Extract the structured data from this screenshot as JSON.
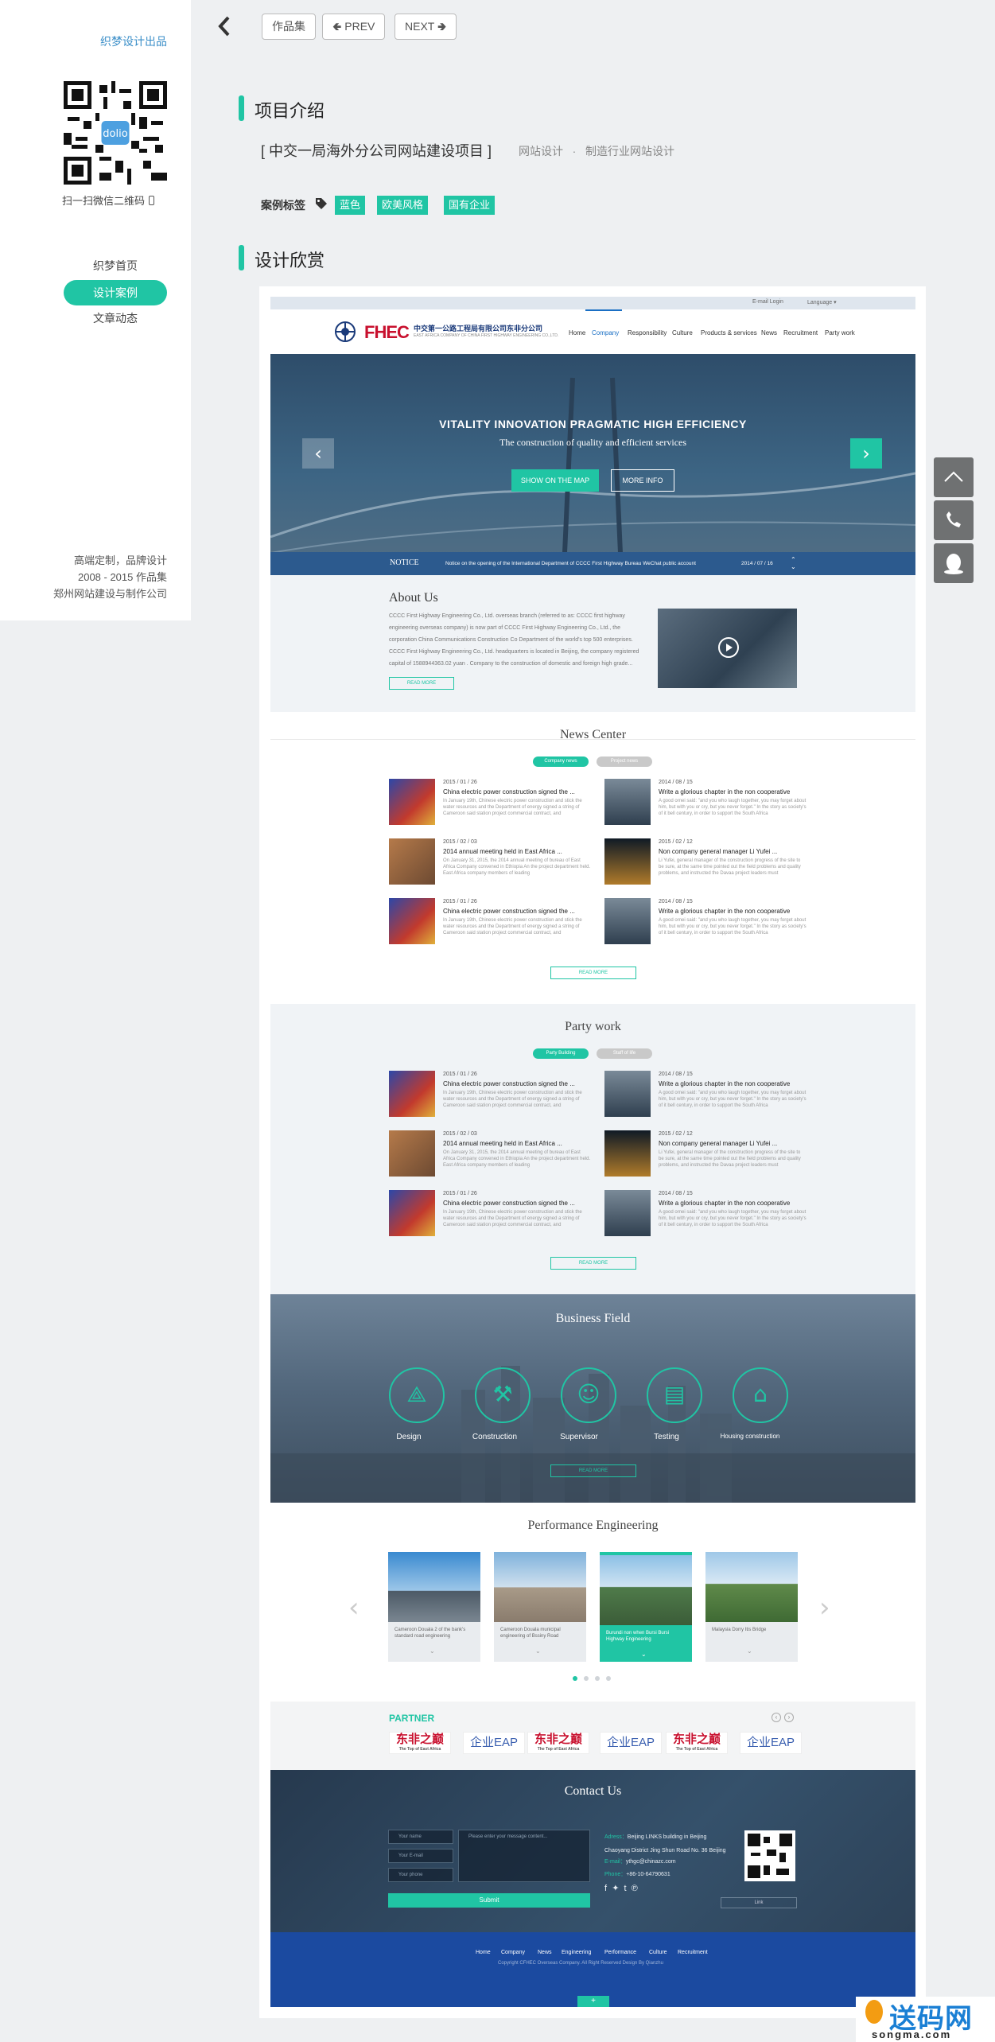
{
  "sidebar": {
    "brand": "织梦设计出品",
    "qr_caption": "扫一扫微信二维码",
    "qr_center": "dolio",
    "nav": [
      "织梦首页",
      "设计案例",
      "文章动态"
    ],
    "footer": [
      "高端定制，品牌设计",
      "2008 - 2015 作品集",
      "郑州网站建设与制作公司"
    ]
  },
  "toolbar": {
    "collection": "作品集",
    "prev": "PREV",
    "next": "NEXT"
  },
  "intro": {
    "heading": "项目介绍",
    "project_title": "[ 中交一局海外分公司网站建设项目 ]",
    "category1": "网站设计",
    "sep": "·",
    "category2": "制造行业网站设计",
    "tags_label": "案例标签",
    "tags": [
      "蓝色",
      "欧美风格",
      "国有企业"
    ]
  },
  "showcase": {
    "heading": "设计欣赏"
  },
  "mock": {
    "topbar": {
      "login": "E-mail Login",
      "language": "Language ▾"
    },
    "logo": {
      "mark": "FHEC",
      "cn": "中交第一公路工程局有限公司东非分公司",
      "en": "EAST AFRICA COMPANY OF CHINA FIRST HIGHWAY ENGINEERING CO.,LTD."
    },
    "menu": [
      "Home",
      "Company",
      "Responsibility",
      "Culture",
      "Products & services",
      "News",
      "Recruitment",
      "Party work"
    ],
    "hero": {
      "headline": "VITALITY  INNOVATION  PRAGMATIC  HIGH EFFICIENCY",
      "sub": "The construction of quality and efficient services",
      "btn_map": "SHOW ON THE MAP",
      "btn_more": "MORE INFO",
      "notice_label": "NOTICE",
      "notice_text": "Notice on the opening of the International Department of CCCC First Highway Bureau WeChat public account",
      "notice_date": "2014 / 07 / 16"
    },
    "about": {
      "title": "About Us",
      "text": "CCCC First Highway Engineering Co., Ltd. overseas branch (referred to as: CCCC first highway engineering overseas company) is now part of CCCC First Highway Engineering Co., Ltd., the corporation China Communications Construction Co Department of the world's top 500 enterprises. CCCC First Highway Engineering Co., Ltd. headquarters is located in Beijing, the company registered capital of 1588944363.02 yuan . Company to the construction of domestic and foreign high grade...",
      "read_more": "READ MORE"
    },
    "news": {
      "title": "News Center",
      "tabs": [
        "Company news",
        "Project news"
      ],
      "read_more": "READ MORE",
      "items": [
        {
          "date": "2015 / 01 / 26",
          "title": "China electric power construction signed the ...",
          "desc": "In January 19th, Chinese electric power construction and stick the water resources and the Department of energy signed a string of Cameroon said station project commercial contract, and"
        },
        {
          "date": "2014 / 08 / 15",
          "title": "Write a glorious chapter in the non cooperative",
          "desc": "A good ornei said: \"and you who laugh together, you may forget about him, but with you or cry, but you never forget.\" In the story as society's of it bell century, in order to support the South Africa"
        },
        {
          "date": "2015 / 02 / 03",
          "title": "2014 annual meeting held in East Africa ...",
          "desc": "On January 31, 2015, the 2014 annual meeting of bureau of East Africa Company convened in Ethiopia An the project department held. East Africa company members of leading"
        },
        {
          "date": "2015 / 02 / 12",
          "title": "Non company general manager Li Yufei ...",
          "desc": "Li Yufei, general manager of the construction progress of the site to be sure, at the same time pointed out the field problems and quality problems, and instructed the Davaa project leaders must"
        },
        {
          "date": "2015 / 01 / 26",
          "title": "China electric power construction signed the ...",
          "desc": "In January 19th, Chinese electric power construction and stick the water resources and the Department of energy signed a string of Cameroon said station project commercial contract, and"
        },
        {
          "date": "2014 / 08 / 15",
          "title": "Write a glorious chapter in the non cooperative",
          "desc": "A good ornei said: \"and you who laugh together, you may forget about him, but with you or cry, but you never forget.\" In the story as society's of it bell century, in order to support the South Africa"
        }
      ]
    },
    "party": {
      "title": "Party work",
      "tabs": [
        "Party Building",
        "Staff of life"
      ],
      "read_more": "READ MORE",
      "items": [
        {
          "date": "2015 / 01 / 26",
          "title": "China electric power construction signed the ...",
          "desc": "In January 19th, Chinese electric power construction and stick the water resources and the Department of energy signed a string of Cameroon said station project commercial contract, and"
        },
        {
          "date": "2014 / 08 / 15",
          "title": "Write a glorious chapter in the non cooperative",
          "desc": "A good ornei said: \"and you who laugh together, you may forget about him, but with you or cry, but you never forget.\" In the story as society's of it bell century, in order to support the South Africa"
        },
        {
          "date": "2015 / 02 / 03",
          "title": "2014 annual meeting held in East Africa ...",
          "desc": "On January 31, 2015, the 2014 annual meeting of bureau of East Africa Company convened in Ethiopia An the project department held. East Africa company members of leading"
        },
        {
          "date": "2015 / 02 / 12",
          "title": "Non company general manager Li Yufei ...",
          "desc": "Li Yufei, general manager of the construction progress of the site to be sure, at the same time pointed out the field problems and quality problems, and instructed the Davaa project leaders must"
        },
        {
          "date": "2015 / 01 / 26",
          "title": "China electric power construction signed the ...",
          "desc": "In January 19th, Chinese electric power construction and stick the water resources and the Department of energy signed a string of Cameroon said station project commercial contract, and"
        },
        {
          "date": "2014 / 08 / 15",
          "title": "Write a glorious chapter in the non cooperative",
          "desc": "A good ornei said: \"and you who laugh together, you may forget about him, but with you or cry, but you never forget.\" In the story as society's of it bell century, in order to support the South Africa"
        }
      ]
    },
    "business": {
      "title": "Business Field",
      "items": [
        "Design",
        "Construction",
        "Supervisor",
        "Testing",
        "Housing construction"
      ],
      "read_more": "READ MORE"
    },
    "performance": {
      "title": "Performance Engineering",
      "items": [
        "Cameroon Douala 2 of the bank's standard road engineering",
        "Cameroon Douala municipal engineering of Bssiny Road",
        "Burundi non when Bursi Bursi Highway Engineering",
        "Malaysia Dorry Itis Bridge"
      ]
    },
    "partner": {
      "title": "PARTNER",
      "logos": [
        "东非之巅",
        "企业EAP",
        "东非之巅",
        "企业EAP",
        "东非之巅",
        "企业EAP"
      ],
      "logo_sub": "The Top of East Africa"
    },
    "contact": {
      "title": "Contact Us",
      "name": "Your name",
      "email": "Your E-mail",
      "phone": "Your phone",
      "message": "Please enter your message content...",
      "submit": "Submit",
      "address_label": "Adress：",
      "address": "Beijing LINKS building in Beijing Chaoyang District Jing Shun Road No. 36 Beijing",
      "email_label": "E-mail：",
      "email_value": "ythgc@chinazc.com",
      "phone_label": "Phone：",
      "phone_value": "+86-10-64790631",
      "select": "Link"
    },
    "footer": {
      "links": [
        "Home",
        "Company",
        "News",
        "Engineering",
        "Performance",
        "Culture",
        "Recruitment"
      ],
      "copyright": "Copyright CFHEC Overseas Company. All Right Reserved      Design By Qianzhu"
    }
  },
  "watermark": {
    "title": "送码网",
    "url": "songma.com"
  },
  "colors": {
    "accent": "#20c5a4",
    "brand_blue": "#3a8ec8",
    "footer_blue": "#1b4aa0"
  }
}
